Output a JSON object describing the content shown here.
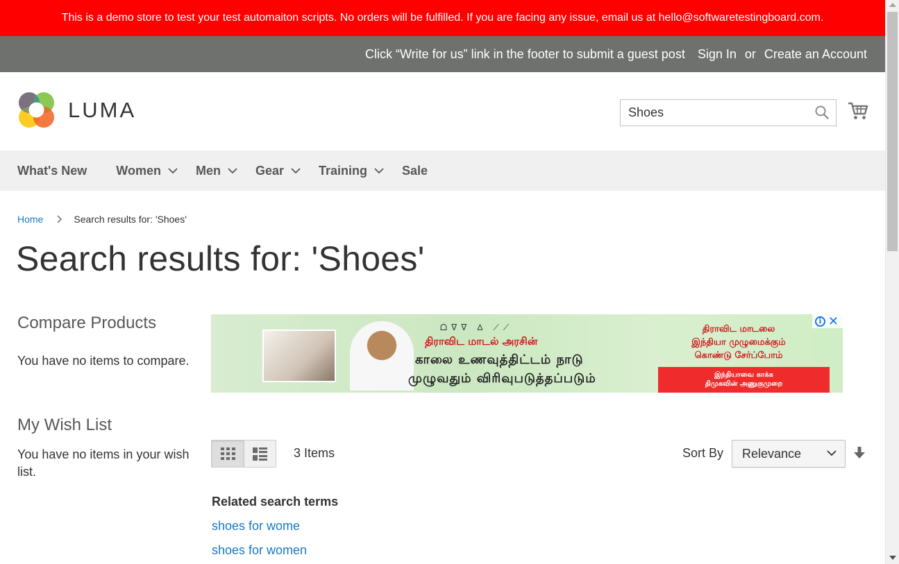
{
  "demo_banner": {
    "text": "This is a demo store to test your test automaiton scripts. No orders will be fulfilled. If you are facing any issue, email us at hello@softwaretestingboard.com.",
    "color": "#ff0000"
  },
  "header_panel": {
    "guest_post_text": "Click “Write for us” link in the footer to submit a guest post",
    "sign_in": "Sign In",
    "or": "or",
    "create_account": "Create an Account"
  },
  "logo": {
    "text": "LUMA",
    "icon": "luma-logo-icon"
  },
  "search": {
    "value": "Shoes",
    "icon": "search-icon"
  },
  "cart": {
    "icon": "cart-icon"
  },
  "nav": {
    "items": [
      {
        "label": "What's New",
        "dropdown": false
      },
      {
        "label": "Women",
        "dropdown": true
      },
      {
        "label": "Men",
        "dropdown": true
      },
      {
        "label": "Gear",
        "dropdown": true
      },
      {
        "label": "Training",
        "dropdown": true
      },
      {
        "label": "Sale",
        "dropdown": false
      }
    ]
  },
  "breadcrumb": {
    "home": "Home",
    "current": "Search results for: 'Shoes'"
  },
  "page_title": "Search results for: 'Shoes'",
  "sidebar": {
    "compare": {
      "title": "Compare Products",
      "empty": "You have no items to compare."
    },
    "wishlist": {
      "title": "My Wish List",
      "empty": "You have no items in your wish list."
    }
  },
  "ad": {
    "top_logos": "ᗝᐁᐁ ∆ ⟋⟋",
    "line1": "திராவிட மாடல் அரசின்",
    "line2": "காலை உணவுத்திட்டம் நாடு",
    "line3": "முழுவதும் விரிவுபடுத்தப்படும்",
    "right_text_1": "திராவிட மாடலை",
    "right_text_2": "இந்தியா முழுமைக்கும்",
    "right_text_3": "கொண்டு சேர்ப்போம்",
    "red_box_1": "இந்தியாவை காக்க",
    "red_box_2": "திமுகவின் அணுகுமுறை",
    "info_icon": "ad-info-icon",
    "close_icon": "ad-close-icon"
  },
  "toolbar": {
    "modes": [
      {
        "name": "grid",
        "icon": "grid-view-icon",
        "active": true
      },
      {
        "name": "list",
        "icon": "list-view-icon",
        "active": false
      }
    ],
    "amount": "3 Items",
    "sort_label": "Sort By",
    "sort_value": "Relevance",
    "sort_direction_icon": "arrow-down-icon"
  },
  "related": {
    "title": "Related search terms",
    "terms": [
      "shoes for wome",
      "shoes for women"
    ]
  }
}
